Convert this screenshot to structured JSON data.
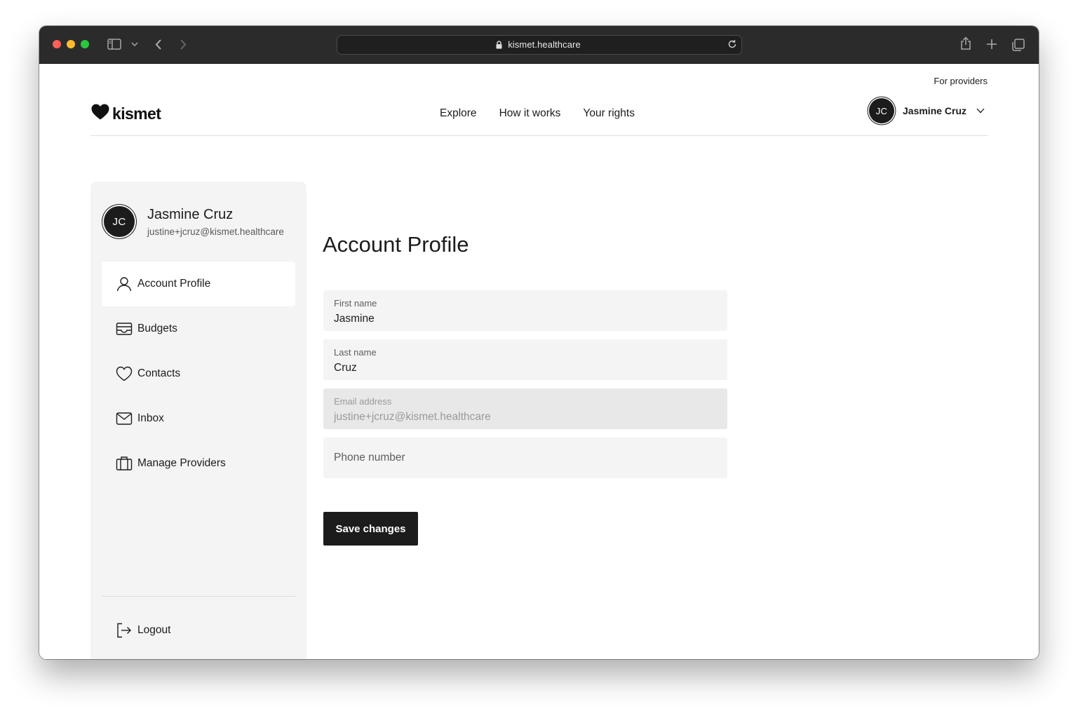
{
  "browser": {
    "url": "kismet.healthcare",
    "traffic_lights": {
      "close": "#ff5f57",
      "minimize": "#febc2e",
      "zoom": "#28c840"
    }
  },
  "header": {
    "for_providers": "For providers",
    "logo_text": "kismet",
    "nav": [
      "Explore",
      "How it works",
      "Your rights"
    ],
    "user": {
      "initials": "JC",
      "name": "Jasmine Cruz"
    }
  },
  "sidebar": {
    "user": {
      "initials": "JC",
      "name": "Jasmine Cruz",
      "email": "justine+jcruz@kismet.healthcare"
    },
    "items": [
      {
        "label": "Account Profile",
        "icon": "user-icon",
        "active": true
      },
      {
        "label": "Budgets",
        "icon": "wallet-icon",
        "active": false
      },
      {
        "label": "Contacts",
        "icon": "heart-icon",
        "active": false
      },
      {
        "label": "Inbox",
        "icon": "mail-icon",
        "active": false
      },
      {
        "label": "Manage Providers",
        "icon": "briefcase-icon",
        "active": false
      }
    ],
    "logout": {
      "label": "Logout",
      "icon": "logout-icon"
    }
  },
  "main": {
    "title": "Account Profile",
    "fields": {
      "first_name": {
        "label": "First name",
        "value": "Jasmine"
      },
      "last_name": {
        "label": "Last name",
        "value": "Cruz"
      },
      "email": {
        "label": "Email address",
        "value": "justine+jcruz@kismet.healthcare",
        "disabled": true
      },
      "phone": {
        "placeholder": "Phone number",
        "value": ""
      }
    },
    "save_label": "Save changes"
  }
}
